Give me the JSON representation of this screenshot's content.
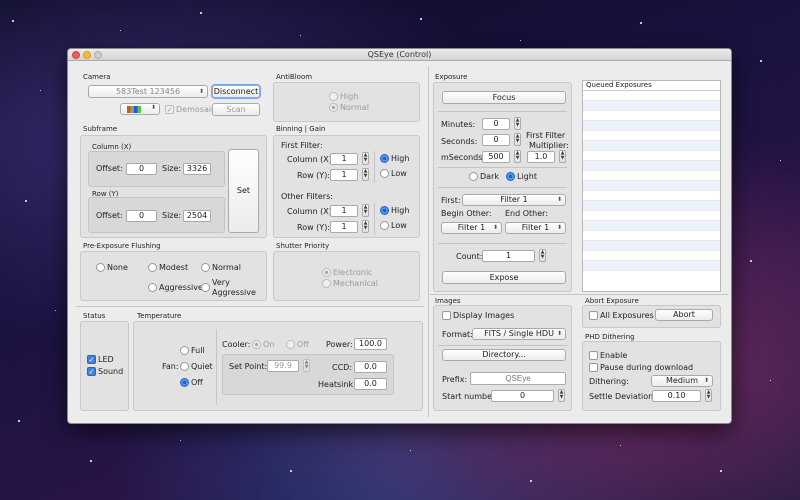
{
  "window": {
    "title": "QSEye (Control)"
  },
  "camera": {
    "section": "Camera",
    "device": "583Test 123456",
    "disconnect": "Disconnect",
    "demosaic": "Demosaic",
    "scan": "Scan"
  },
  "antibloom": {
    "section": "AntiBloom",
    "high": "High",
    "normal": "Normal",
    "selected": "Normal"
  },
  "subframe": {
    "section": "Subframe",
    "column_label": "Column (X)",
    "row_label": "Row (Y)",
    "offset_label": "Offset:",
    "size_label": "Size:",
    "col_offset": "0",
    "col_size": "3326",
    "row_offset": "0",
    "row_size": "2504",
    "set": "Set"
  },
  "binning": {
    "section": "Binning | Gain",
    "first_filter": "First Filter:",
    "other_filters": "Other Filters:",
    "column_label": "Column (X):",
    "row_label": "Row (Y):",
    "ff_col": "1",
    "ff_row": "1",
    "of_col": "1",
    "of_row": "1",
    "high": "High",
    "low": "Low"
  },
  "flushing": {
    "section": "Pre-Exposure Flushing",
    "none": "None",
    "modest": "Modest",
    "normal": "Normal",
    "aggressive": "Aggressive",
    "very_aggressive_1": "Very",
    "very_aggressive_2": "Aggressive"
  },
  "shutter": {
    "section": "Shutter Priority",
    "electronic": "Electronic",
    "mechanical": "Mechanical"
  },
  "status": {
    "section": "Status",
    "led": "LED",
    "sound": "Sound"
  },
  "temperature": {
    "section": "Temperature",
    "fan_label": "Fan:",
    "full": "Full",
    "quiet": "Quiet",
    "off": "Off",
    "cooler_label": "Cooler:",
    "cooler_on": "On",
    "cooler_off": "Off",
    "power_label": "Power:",
    "power": "100.0",
    "setpoint_label": "Set Point:",
    "setpoint": "99.9",
    "ccd_label": "CCD:",
    "ccd": "0.0",
    "heatsink_label": "Heatsink:",
    "heatsink": "0.0"
  },
  "exposure": {
    "section": "Exposure",
    "focus": "Focus",
    "minutes_label": "Minutes:",
    "minutes": "0",
    "seconds_label": "Seconds:",
    "seconds": "0",
    "mseconds_label": "mSeconds:",
    "mseconds": "500",
    "multiplier_label_1": "First Filter",
    "multiplier_label_2": "Multiplier:",
    "multiplier": "1.0",
    "dark": "Dark",
    "light": "Light",
    "first_label": "First:",
    "first_filter": "Filter 1",
    "begin_other_label": "Begin Other:",
    "end_other_label": "End Other:",
    "begin_other": "Filter 1",
    "end_other": "Filter 1",
    "count_label": "Count:",
    "count": "1",
    "expose": "Expose"
  },
  "queued": {
    "header": "Queued Exposures",
    "rows": 18
  },
  "images": {
    "section": "Images",
    "display_images": "Display Images",
    "format_label": "Format:",
    "format": "FITS / Single HDU",
    "directory": "Directory...",
    "prefix_label": "Prefix:",
    "prefix_placeholder": "QSEye",
    "start_label": "Start number:",
    "start_number": "0"
  },
  "abort": {
    "section": "Abort Exposure",
    "all_exposures": "All Exposures",
    "abort": "Abort"
  },
  "phd": {
    "section": "PHD Dithering",
    "enable": "Enable",
    "pause": "Pause during download",
    "dithering_label": "Dithering:",
    "dithering": "Medium",
    "settle_label": "Settle Deviation:",
    "settle": "0.10"
  }
}
